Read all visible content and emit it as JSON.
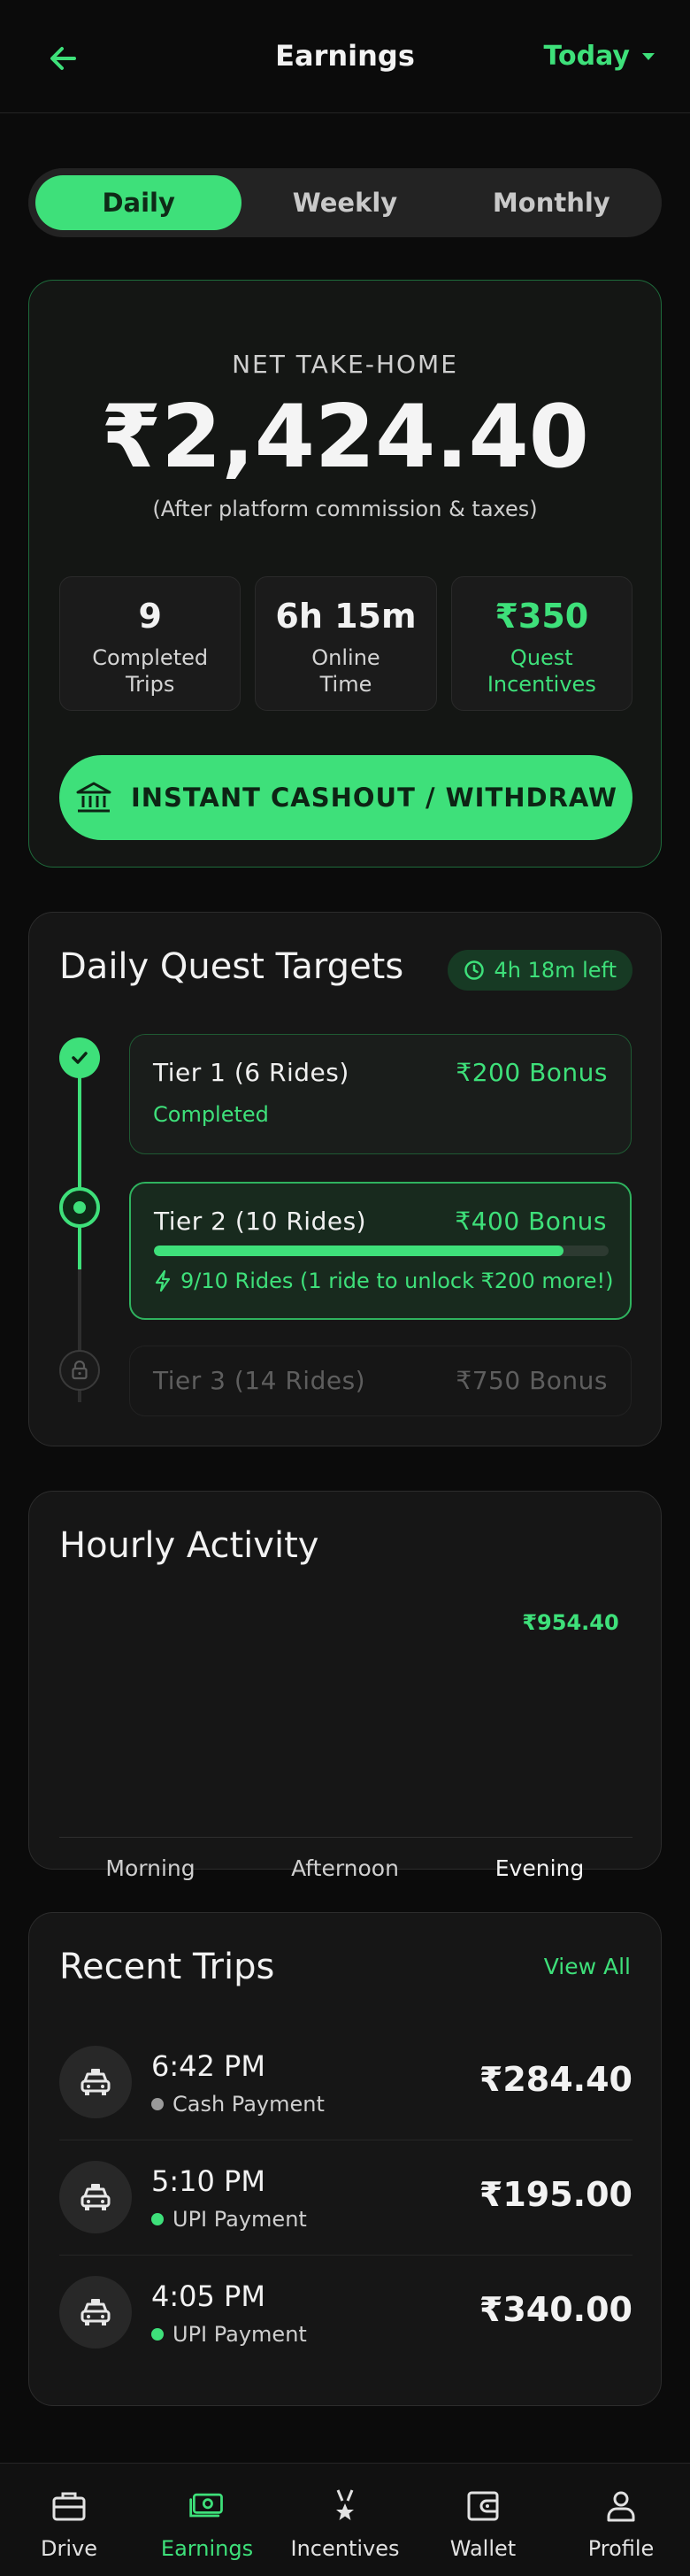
{
  "header": {
    "title": "Earnings",
    "period": "Today"
  },
  "tabs": [
    {
      "label": "Daily",
      "active": true
    },
    {
      "label": "Weekly",
      "active": false
    },
    {
      "label": "Monthly",
      "active": false
    }
  ],
  "summary": {
    "label": "NET TAKE-HOME",
    "amount": "₹2,424.40",
    "note": "(After platform commission & taxes)",
    "stats": [
      {
        "value": "9",
        "label_line1": "Completed",
        "label_line2": "Trips"
      },
      {
        "value": "6h 15m",
        "label_line1": "Online",
        "label_line2": "Time"
      },
      {
        "value": "₹350",
        "label_line1": "Quest",
        "label_line2": "Incentives"
      }
    ],
    "cashout_label": "INSTANT CASHOUT / WITHDRAW"
  },
  "quests": {
    "title": "Daily Quest Targets",
    "time_left": "4h 18m left",
    "tiers": [
      {
        "name": "Tier 1 (6 Rides)",
        "bonus": "₹200 Bonus",
        "status": "Completed"
      },
      {
        "name": "Tier 2 (10 Rides)",
        "bonus": "₹400 Bonus",
        "progress": 0.9,
        "note": "9/10 Rides (1 ride to unlock ₹200 more!)"
      },
      {
        "name": "Tier 3 (14 Rides)",
        "bonus": "₹750 Bonus",
        "locked": true
      }
    ]
  },
  "hourly": {
    "title": "Hourly Activity",
    "labels": [
      "Morning",
      "Afternoon",
      "Evening"
    ],
    "active_label": "Evening",
    "highlight_value": "₹954.40"
  },
  "trips": {
    "title": "Recent Trips",
    "view_all": "View All",
    "items": [
      {
        "time": "6:42 PM",
        "payment": "Cash Payment",
        "dot_color": "#9a9a9a",
        "amount": "₹284.40"
      },
      {
        "time": "5:10 PM",
        "payment": "UPI Payment",
        "dot_color": "#3ee07a",
        "amount": "₹195.00"
      },
      {
        "time": "4:05 PM",
        "payment": "UPI Payment",
        "dot_color": "#3ee07a",
        "amount": "₹340.00"
      }
    ]
  },
  "nav": [
    {
      "label": "Drive",
      "icon": "briefcase-icon"
    },
    {
      "label": "Earnings",
      "icon": "cash-icon",
      "active": true
    },
    {
      "label": "Incentives",
      "icon": "medal-icon"
    },
    {
      "label": "Wallet",
      "icon": "wallet-icon"
    },
    {
      "label": "Profile",
      "icon": "profile-icon"
    }
  ],
  "colors": {
    "accent": "#3ee07a",
    "background": "#0b0b0b",
    "card": "#161616"
  }
}
